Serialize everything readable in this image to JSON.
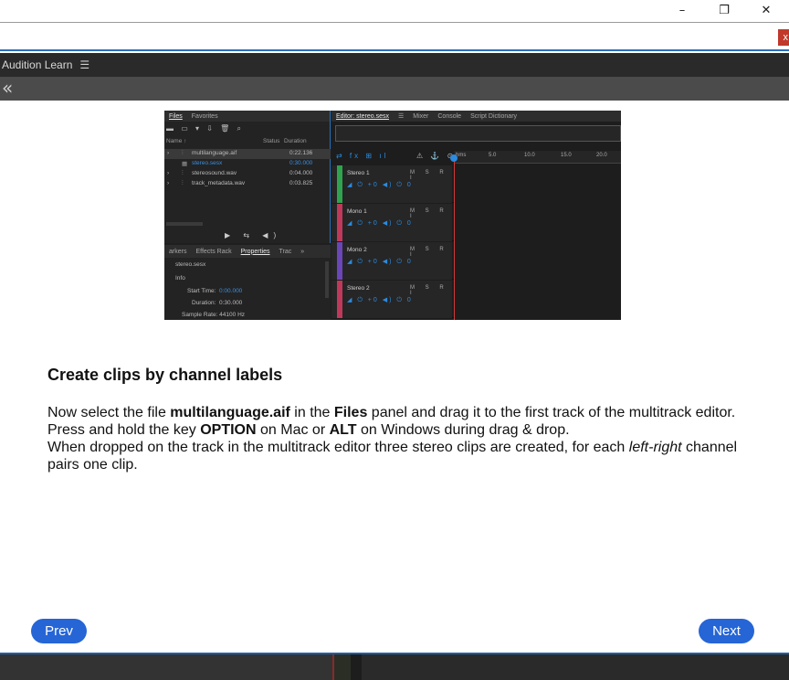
{
  "window": {
    "minimize": "–",
    "maximize": "❐",
    "close": "✕"
  },
  "urlbar": {
    "close": "x"
  },
  "app": {
    "title": "Audition Learn",
    "menu_icon": "☰",
    "back_icon": "«"
  },
  "screenshot": {
    "files_tabs": [
      "Files",
      "Favorites"
    ],
    "files_toolbar": "▬ ▭ ▾ ⇩ 🗑 ⌕",
    "columns": {
      "name": "Name ↑",
      "status": "Status",
      "duration": "Duration"
    },
    "files": [
      {
        "name": "multilanguage.aif",
        "duration": "0:22.136"
      },
      {
        "name": "stereo.sesx",
        "duration": "0:30.000"
      },
      {
        "name": "stereosound.wav",
        "duration": "0:04.000"
      },
      {
        "name": "track_metadata.wav",
        "duration": "0:03.825"
      }
    ],
    "transport": "▶ ⇆ ◀)",
    "props_tabs": [
      "arkers",
      "Effects Rack",
      "Properties",
      "Trac",
      "»"
    ],
    "props_file": "stereo.sesx",
    "props_section": "Info",
    "props_start_label": "Start Time:",
    "props_start_value": "0:00.000",
    "props_duration_label": "Duration:",
    "props_duration_value": "0:30.000",
    "props_samplerate": "Sample Rate: 44100 Hz",
    "editor_tabs": [
      "Editor: stereo.sesx",
      "☰",
      "Mixer",
      "Console",
      "Script Dictionary"
    ],
    "editor_tools": "⇄ fx ⊞ ıl",
    "editor_tools2": "⚠ ⚓ ⊙",
    "ruler": [
      "hms",
      "5.0",
      "10.0",
      "15.0",
      "20.0"
    ],
    "tracks": [
      {
        "name": "Stereo 1",
        "color": "#2fa34d"
      },
      {
        "name": "Mono 1",
        "color": "#c0395a"
      },
      {
        "name": "Mono 2",
        "color": "#6a46b8"
      },
      {
        "name": "Stereo 2",
        "color": "#c0395a"
      }
    ],
    "track_msr": "M S R I",
    "track_ctl": "◢ ⏻ +0  ◀) ⏻ 0"
  },
  "lesson": {
    "heading": "Create clips by channel labels",
    "p1_a": "Now select the file ",
    "p1_b": "multilanguage.aif",
    "p1_c": " in the ",
    "p1_d": "Files",
    "p1_e": " panel and drag it to the first track of the multitrack editor. Press and hold the key ",
    "p1_f": "OPTION",
    "p1_g": " on Mac or ",
    "p1_h": "ALT",
    "p1_i": " on Windows during drag & drop.",
    "p2_a": "When dropped on the track in the multitrack editor three stereo clips are created, for each ",
    "p2_b": "left-right",
    "p2_c": " channel pairs one clip."
  },
  "nav": {
    "prev": "Prev",
    "next": "Next"
  }
}
